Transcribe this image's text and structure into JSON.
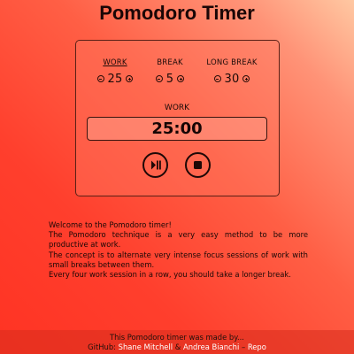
{
  "header": {
    "title": "Pomodoro Timer"
  },
  "settings": [
    {
      "label": "WORK",
      "value": "25",
      "active": true
    },
    {
      "label": "BREAK",
      "value": "5",
      "active": false
    },
    {
      "label": "LONG BREAK",
      "value": "30",
      "active": false
    }
  ],
  "timer": {
    "mode": "WORK",
    "display": "25:00"
  },
  "controls": {
    "play_pause_icon": "play-pause-icon",
    "stop_icon": "stop-icon"
  },
  "description": [
    "Welcome to the Pomodoro timer!",
    "The Pomodoro technique is a very easy method to be more productive at work.",
    "The concept is to alternate very intense focus sessions of work with small breaks between them.",
    "Every four work session in a row, you should take a longer break."
  ],
  "footer": {
    "line1": "This Pomodoro timer was made by...",
    "github_label": "GitHub:",
    "author1": "Shane Mitchell",
    "ampersand": "&",
    "author2": "Andrea Bianchi",
    "dash": "–",
    "repo": "Repo"
  },
  "colors": {
    "background_start": "#ffc8a2",
    "background_end": "#ff3323",
    "link": "#ffffff"
  }
}
